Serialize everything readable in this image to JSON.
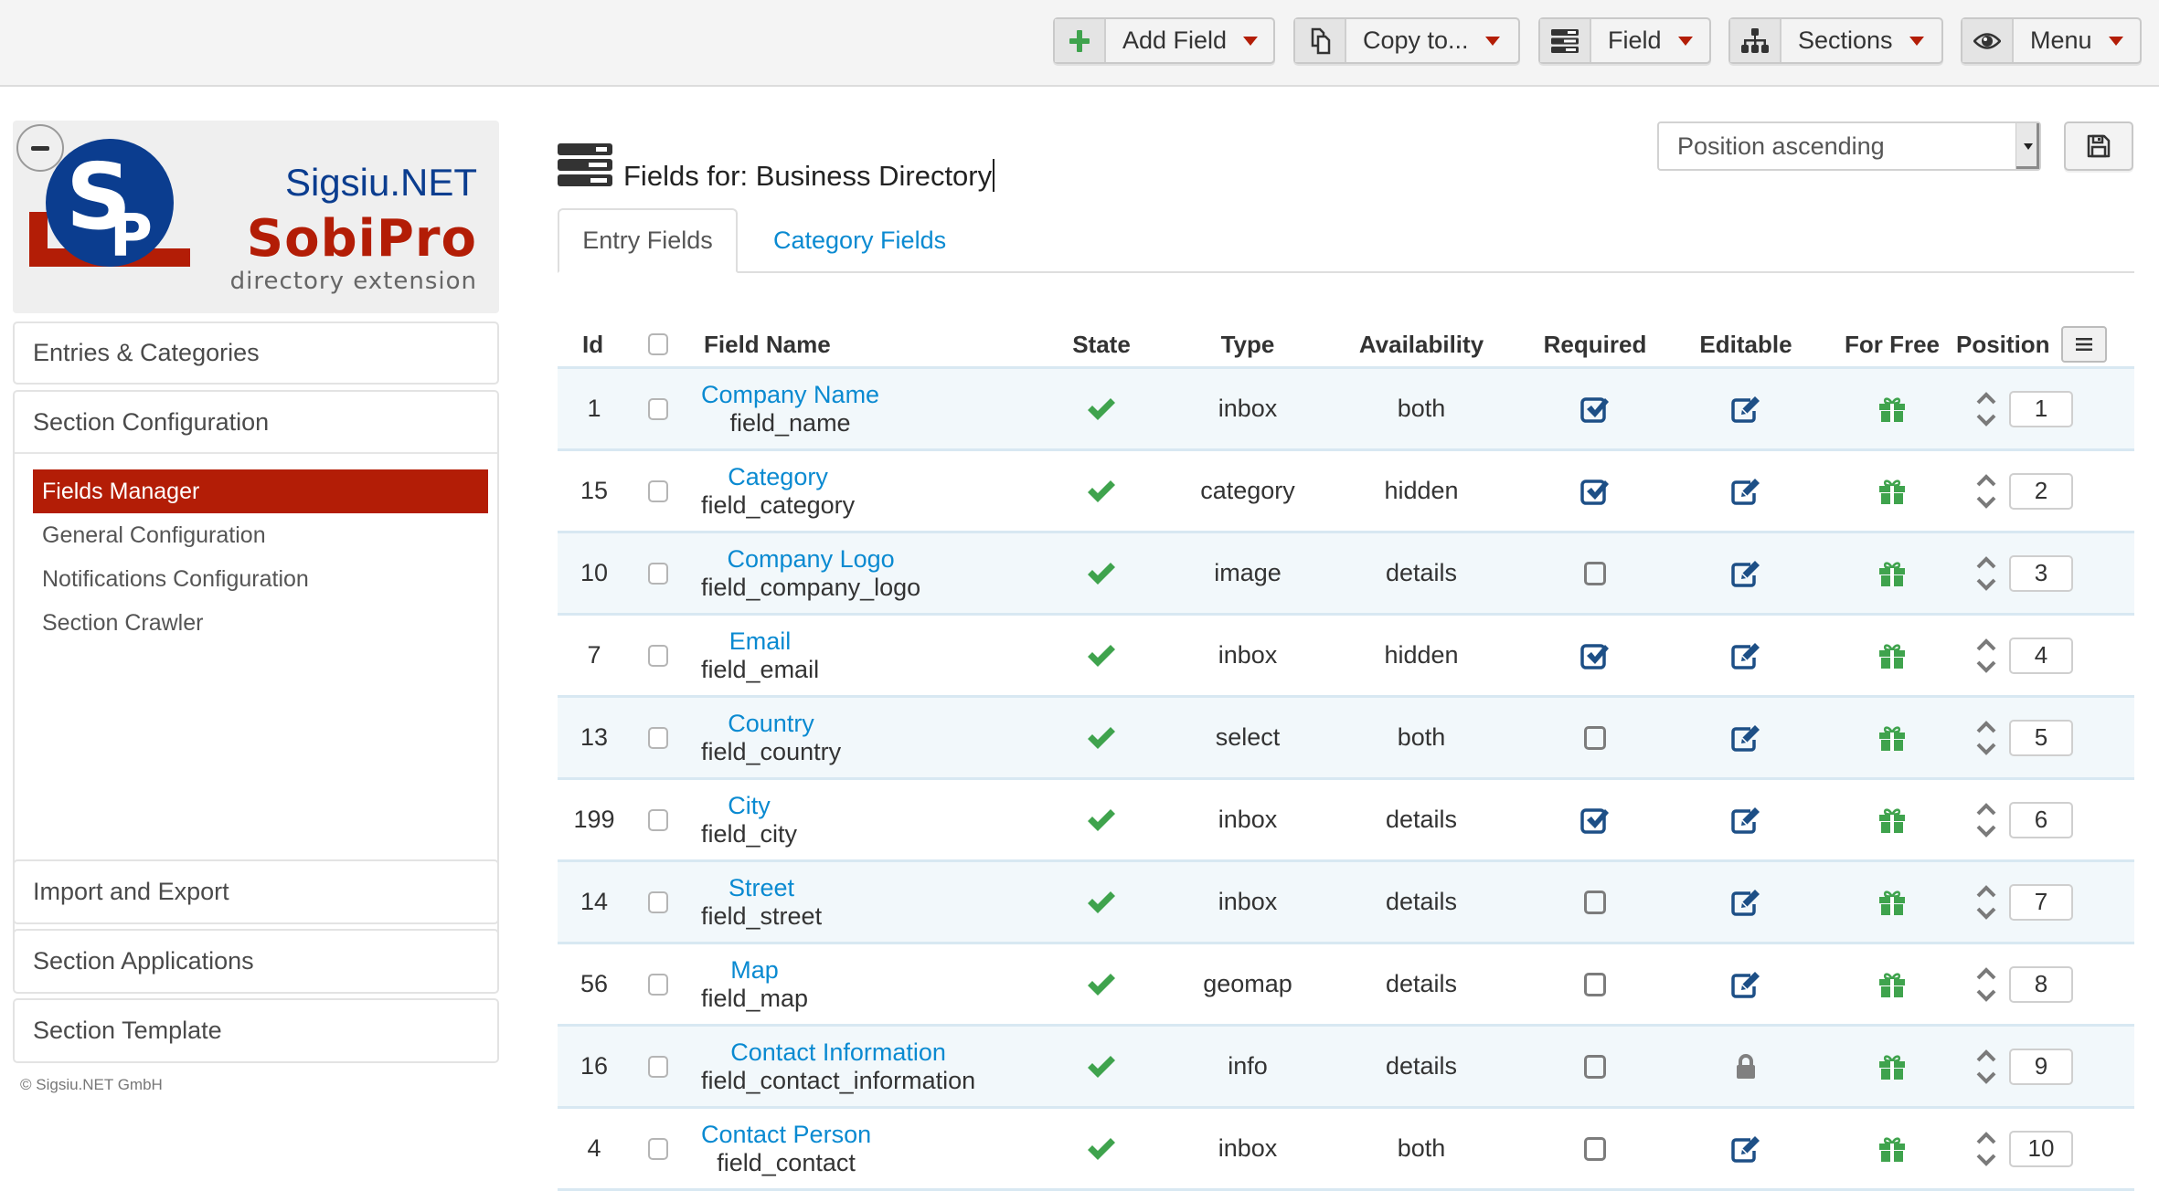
{
  "toolbar": {
    "buttons": [
      {
        "label": "Add Field",
        "icon": "plus-icon"
      },
      {
        "label": "Copy to...",
        "icon": "copy-icon"
      },
      {
        "label": "Field",
        "icon": "server-icon"
      },
      {
        "label": "Sections",
        "icon": "sitemap-icon"
      },
      {
        "label": "Menu",
        "icon": "eye-icon"
      }
    ]
  },
  "sidebar": {
    "logo": {
      "brand": "Sigsiu.NET",
      "product": "SobiPro",
      "tagline": "directory extension"
    },
    "panels": [
      {
        "label": "Entries & Categories"
      },
      {
        "label": "Section Configuration",
        "items": [
          {
            "label": "Fields Manager",
            "active": true
          },
          {
            "label": "General Configuration"
          },
          {
            "label": "Notifications Configuration"
          },
          {
            "label": "Section Crawler"
          }
        ]
      },
      {
        "label": "Import and Export"
      },
      {
        "label": "Section Applications"
      },
      {
        "label": "Section Template"
      }
    ],
    "copyright": "© Sigsiu.NET GmbH"
  },
  "main": {
    "title": "Fields for: Business Directory",
    "sort": {
      "selected": "Position ascending"
    },
    "tabs": [
      {
        "label": "Entry Fields",
        "active": true
      },
      {
        "label": "Category Fields"
      }
    ],
    "columns": [
      "Id",
      "Field Name",
      "State",
      "Type",
      "Availability",
      "Required",
      "Editable",
      "For Free",
      "Position"
    ],
    "rows": [
      {
        "id": "1",
        "name": "Company Name",
        "alias": "field_name",
        "state": "published",
        "type": "inbox",
        "availability": "both",
        "required": true,
        "editable": true,
        "free": true,
        "position": "1"
      },
      {
        "id": "15",
        "name": "Category",
        "alias": "field_category",
        "state": "published",
        "type": "category",
        "availability": "hidden",
        "required": true,
        "editable": true,
        "free": true,
        "position": "2"
      },
      {
        "id": "10",
        "name": "Company Logo",
        "alias": "field_company_logo",
        "state": "published",
        "type": "image",
        "availability": "details",
        "required": false,
        "editable": true,
        "free": true,
        "position": "3"
      },
      {
        "id": "7",
        "name": "Email",
        "alias": "field_email",
        "state": "published",
        "type": "inbox",
        "availability": "hidden",
        "required": true,
        "editable": true,
        "free": true,
        "position": "4"
      },
      {
        "id": "13",
        "name": "Country",
        "alias": "field_country",
        "state": "published",
        "type": "select",
        "availability": "both",
        "required": false,
        "editable": true,
        "free": true,
        "position": "5"
      },
      {
        "id": "199",
        "name": "City",
        "alias": "field_city",
        "state": "published",
        "type": "inbox",
        "availability": "details",
        "required": true,
        "editable": true,
        "free": true,
        "position": "6"
      },
      {
        "id": "14",
        "name": "Street",
        "alias": "field_street",
        "state": "published",
        "type": "inbox",
        "availability": "details",
        "required": false,
        "editable": true,
        "free": true,
        "position": "7"
      },
      {
        "id": "56",
        "name": "Map",
        "alias": "field_map",
        "state": "published",
        "type": "geomap",
        "availability": "details",
        "required": false,
        "editable": true,
        "free": true,
        "position": "8"
      },
      {
        "id": "16",
        "name": "Contact Information",
        "alias": "field_contact_information",
        "state": "published",
        "type": "info",
        "availability": "details",
        "required": false,
        "editable": false,
        "free": true,
        "position": "9"
      },
      {
        "id": "4",
        "name": "Contact Person",
        "alias": "field_contact",
        "state": "published",
        "type": "inbox",
        "availability": "both",
        "required": false,
        "editable": true,
        "free": true,
        "position": "10"
      }
    ]
  },
  "colors": {
    "accent_red": "#b31d06",
    "link_blue": "#0a8ad1",
    "check_green": "#3fa34d",
    "icon_navy": "#1d4f86",
    "row_stripe": "#f2f8fb"
  }
}
